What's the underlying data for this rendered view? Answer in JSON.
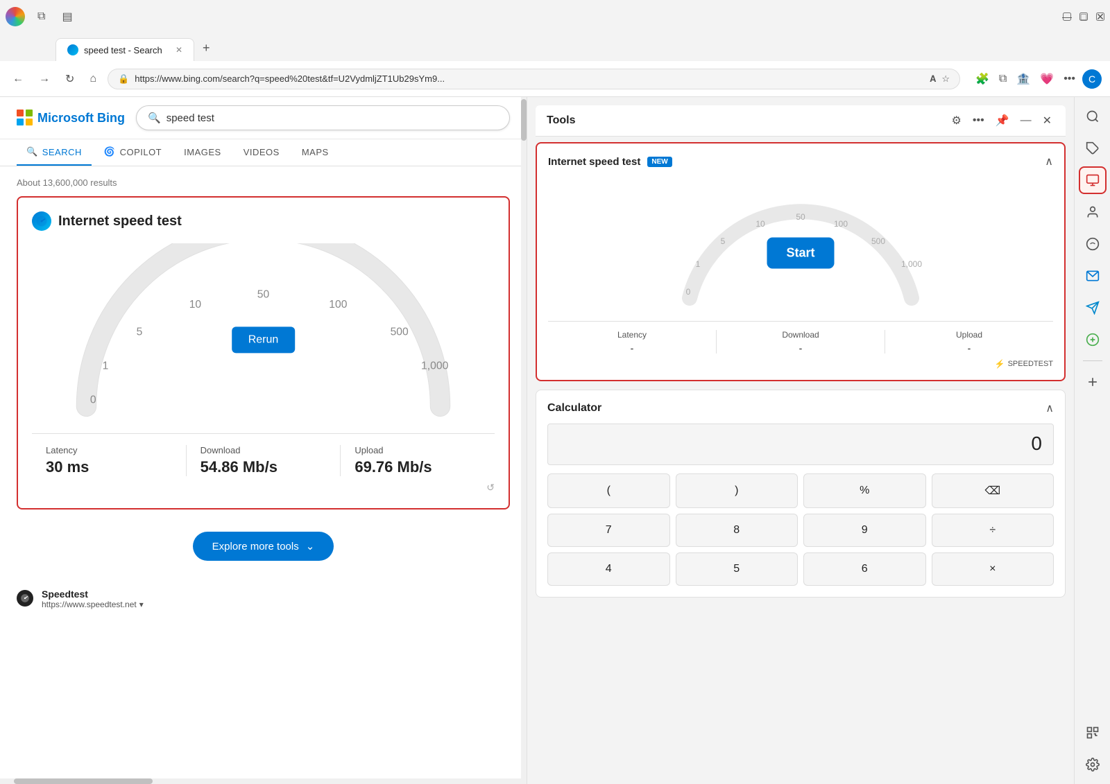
{
  "browser": {
    "tab_title": "speed test - Search",
    "url": "https://www.bing.com/search?q=speed%20test&tf=U2VydmljZT1Ub29sYm9...",
    "new_tab_label": "+",
    "back_btn": "←",
    "forward_btn": "→",
    "refresh_btn": "↻",
    "home_btn": "⌂",
    "window_minimize": "—",
    "window_maximize": "□",
    "window_close": "✕"
  },
  "bing": {
    "logo_text": "Microsoft Bing",
    "search_query": "speed test",
    "results_count": "About 13,600,000 results",
    "nav_items": [
      {
        "label": "SEARCH",
        "active": true
      },
      {
        "label": "COPILOT",
        "active": false
      },
      {
        "label": "IMAGES",
        "active": false
      },
      {
        "label": "VIDEOS",
        "active": false
      },
      {
        "label": "MAPS",
        "active": false
      }
    ],
    "speed_widget": {
      "title": "Internet speed test",
      "rerun_label": "Rerun",
      "gauge_labels": [
        "0",
        "1",
        "5",
        "10",
        "50",
        "100",
        "500",
        "1,000"
      ],
      "latency_label": "Latency",
      "latency_value": "30 ms",
      "download_label": "Download",
      "download_value": "54.86 Mb/s",
      "upload_label": "Upload",
      "upload_value": "69.76 Mb/s"
    },
    "explore_btn_label": "Explore more tools",
    "result_item": {
      "title": "Speedtest",
      "url": "https://www.speedtest.net"
    }
  },
  "tools_panel": {
    "title": "Tools",
    "speed_test_card": {
      "title": "Internet speed test",
      "badge": "NEW",
      "start_label": "Start",
      "gauge_labels": [
        "0",
        "1",
        "5",
        "10",
        "50",
        "100",
        "500",
        "1,000"
      ],
      "latency_label": "Latency",
      "latency_value": "-",
      "download_label": "Download",
      "download_value": "-",
      "upload_label": "Upload",
      "upload_value": "-",
      "brand": "SPEEDTEST"
    },
    "calculator_card": {
      "title": "Calculator",
      "display_value": "0",
      "buttons": [
        {
          "label": "(",
          "type": "normal"
        },
        {
          "label": ")",
          "type": "normal"
        },
        {
          "label": "%",
          "type": "normal"
        },
        {
          "label": "⌫",
          "type": "normal"
        },
        {
          "label": "7",
          "type": "normal"
        },
        {
          "label": "8",
          "type": "normal"
        },
        {
          "label": "9",
          "type": "normal"
        },
        {
          "label": "÷",
          "type": "normal"
        },
        {
          "label": "4",
          "type": "normal"
        },
        {
          "label": "5",
          "type": "normal"
        },
        {
          "label": "6",
          "type": "normal"
        },
        {
          "label": "×",
          "type": "normal"
        }
      ]
    }
  },
  "right_sidebar": {
    "icons": [
      {
        "name": "search-icon",
        "symbol": "🔍"
      },
      {
        "name": "tag-icon",
        "symbol": "🏷️"
      },
      {
        "name": "tools-icon",
        "symbol": "🧰",
        "active": true
      },
      {
        "name": "person-icon",
        "symbol": "👤"
      },
      {
        "name": "copilot-icon",
        "symbol": "🌀"
      },
      {
        "name": "outlook-icon",
        "symbol": "📧"
      },
      {
        "name": "telegram-icon",
        "symbol": "✈"
      },
      {
        "name": "game-icon",
        "symbol": "🌿"
      },
      {
        "name": "add-icon",
        "symbol": "+"
      },
      {
        "name": "scan-icon",
        "symbol": "⊞"
      },
      {
        "name": "settings-icon",
        "symbol": "⚙"
      }
    ]
  }
}
